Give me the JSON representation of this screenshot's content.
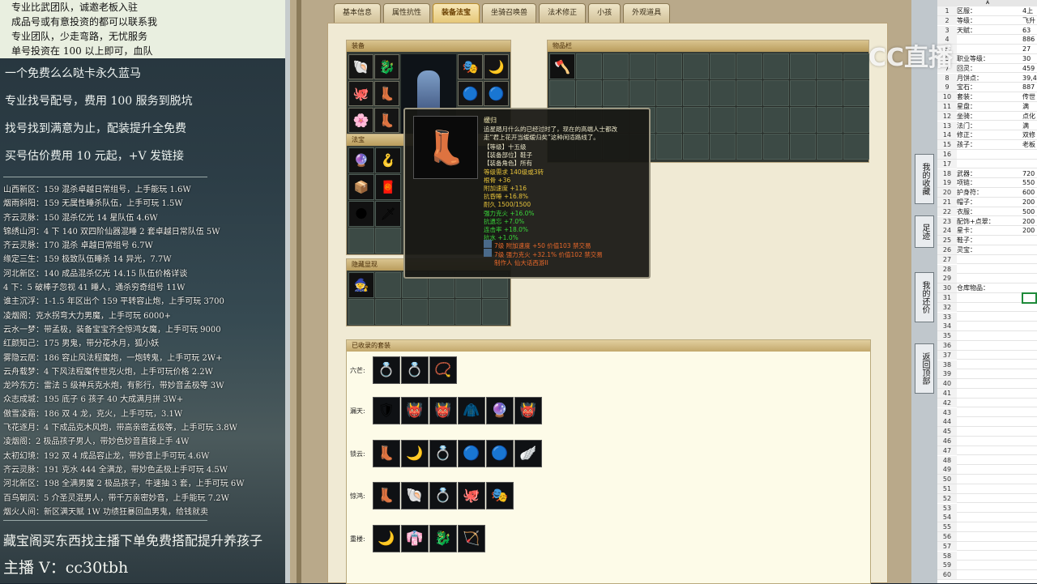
{
  "left_overlay": {
    "top_notice": [
      "专业比武团队，诚邀老板入驻",
      "成品号或有意投资的都可以联系我",
      "专业团队，少走弯路，无忧服务",
      "单号投资在 100 以上即可，血队"
    ],
    "promos": [
      "一个免费么么哒卡永久蓝马",
      "专业找号配号，费用 100 服务到脱坑",
      "找号找到满意为止，配装提升全免费",
      "买号估价费用 10 元起，+V 发链接"
    ],
    "listings": [
      "山西新区：159 混杀卓越日常组号，上手能玩 1.6W",
      "烟雨斜阳：159 无属性睡杀队伍，上手可玩 1.5W",
      "齐云灵脉：150 混杀亿光 14 星队伍 4.6W",
      "锦绣山河：4 下 140 双四阶仙器混睡 2 套卓越日常队伍 5W",
      "齐云灵脉：170 混杀 卓越日常组号 6.7W",
      "缘定三生：159 极致队伍睡杀 14 异光，7.7W",
      "河北新区：140 成品混杀亿光 14.15 队伍价格详谈",
      "4 下：5 破棒子忽视 41 睡人，通杀穷奇组号 11W",
      "谁主沉浮：1-1.5 年区出个 159 平转容止炮，上手可玩 3700",
      "凌烟阁：克水拐弯大力男魔，上手可玩 6000+",
      "云水一梦：带孟极，装备宝宝齐全惊鸿女魔，上手可玩 9000",
      "红颜知己：175 男鬼，带分花水月，狐小妖",
      "雾隐云居：186 容止风法程魔炮，一炮转鬼，上手可玩 2W+",
      "云舟载梦：4 下风法程魔传世克火炮，上手可玩价格 2.2W",
      "龙吟东方：雷法 5 级神兵克水炮，有影行，带妙音孟极等 3W",
      "众志成城：195 底子 6 孩子 40 大成满月拼 3W+",
      "傲雪凌霜：186 双 4 龙，克火，上手可玩，3.1W",
      "飞花逐月：4 下成品克木风炮，带高亲密孟极等，上手可玩 3.8W",
      "凌烟阁：2 极品孩子男人，带妙色妙音直接上手 4W",
      "太初幻境：192 双 4 成品容止龙，带妙音上手可玩 4.6W",
      "齐云灵脉：191 克水 444 全满龙，带妙色孟极上手可玩 4.5W",
      "河北新区：198 全满男魔 2 极品孩子，牛速抽 3 套，上手可玩 6W",
      "百鸟朝凤：5 介圣灵混男人，带千万亲密妙音，上手能玩 7.2W",
      "烟火人间：新区满天赋 1W 功绩狂暴回血男鬼，给钱就卖"
    ],
    "promo_bottom": "藏宝阁买东西找主播下单免费搭配提升养孩子",
    "streamer": "主播 V：cc30tbh"
  },
  "game": {
    "tabs": [
      "基本信息",
      "属性抗性",
      "装备法宝",
      "坐骑召唤兽",
      "法术修正",
      "小孩",
      "外观道具"
    ],
    "active_tab": "装备法宝",
    "equip_title": "装备",
    "inventory_title": "物品栏",
    "fabao_title": "法宝",
    "hidden_title": "隐藏显现",
    "sets_title": "已收录的套装",
    "sets": [
      {
        "name": "六芒:",
        "count": 3,
        "icons": [
          "💍",
          "💍",
          "📿"
        ]
      },
      {
        "name": "漏天:",
        "count": 6,
        "icons": [
          "🛡",
          "👹",
          "👹",
          "🧥",
          "🔮",
          "👹"
        ]
      },
      {
        "name": "锁云:",
        "count": 6,
        "icons": [
          "👢",
          "🌙",
          "💍",
          "🔵",
          "🔵",
          "🪽"
        ]
      },
      {
        "name": "惊鸿:",
        "count": 5,
        "icons": [
          "👢",
          "🐚",
          "💍",
          "🐙",
          "🎭"
        ]
      },
      {
        "name": "重楼:",
        "count": 4,
        "icons": [
          "🌙",
          "👘",
          "🐉",
          "🏹"
        ]
      }
    ],
    "tooltip": {
      "name": "缓归",
      "desc1": "追星踏月什么的已经过时了，现在的高端人士都改",
      "desc2": "走“君上花开当缓缓归矣”这种闲适路线了。",
      "stats": [
        {
          "t": "【等级】十五级",
          "c": "#e8e3c6"
        },
        {
          "t": "【装备部位】鞋子",
          "c": "#e8e3c6"
        },
        {
          "t": "【装备角色】所有",
          "c": "#e8e3c6"
        },
        {
          "t": "等级需求 140级或3转",
          "c": "#e6c23a"
        },
        {
          "t": "根骨 +36",
          "c": "#e6c23a"
        },
        {
          "t": "附加速度 +116",
          "c": "#e6c23a"
        },
        {
          "t": "抗昏睡 +16.8%",
          "c": "#e6c23a"
        },
        {
          "t": "耐久 1500/1500",
          "c": "#e6c23a"
        },
        {
          "t": "强力克火 +16.0%",
          "c": "#3ad43a"
        },
        {
          "t": "抗遗忘 +7.0%",
          "c": "#3ad43a"
        },
        {
          "t": "连击率 +18.0%",
          "c": "#3ad43a"
        },
        {
          "t": "抗水 +1.0%",
          "c": "#3ad43a"
        },
        {
          "t": "7级 附加速度 +50 价值103 禁交易",
          "c": "#e8682a"
        },
        {
          "t": "7级 强力克火 +32.1% 价值102 禁交易",
          "c": "#e8682a"
        },
        {
          "t": "制作人 仙大话西游II",
          "c": "#e8682a"
        }
      ]
    }
  },
  "sidebar": {
    "buttons": [
      "我的收藏",
      "足迹",
      "我的还价",
      "返回顶部"
    ]
  },
  "sheet": {
    "col_header": "A",
    "rows": [
      {
        "n": "1",
        "a": "区服：",
        "b": "4上"
      },
      {
        "n": "2",
        "a": "等级：",
        "b": "飞升"
      },
      {
        "n": "3",
        "a": "天赋：",
        "b": "63"
      },
      {
        "n": "4",
        "a": "",
        "b": "886"
      },
      {
        "n": "5",
        "a": "",
        "b": "27"
      },
      {
        "n": "6",
        "a": "职业等级：",
        "b": "30"
      },
      {
        "n": "7",
        "a": "回灵：",
        "b": "459"
      },
      {
        "n": "8",
        "a": "月饼点：",
        "b": "39,4"
      },
      {
        "n": "9",
        "a": "宝石：",
        "b": "887"
      },
      {
        "n": "10",
        "a": "套装：",
        "b": "传世"
      },
      {
        "n": "11",
        "a": "星盘：",
        "b": "满"
      },
      {
        "n": "12",
        "a": "坐骑：",
        "b": "点化"
      },
      {
        "n": "13",
        "a": "法门：",
        "b": "满"
      },
      {
        "n": "14",
        "a": "修正：",
        "b": "双修"
      },
      {
        "n": "15",
        "a": "孩子：",
        "b": "老板"
      },
      {
        "n": "16",
        "a": "",
        "b": ""
      },
      {
        "n": "17",
        "a": "",
        "b": ""
      },
      {
        "n": "18",
        "a": "武器：",
        "b": "720"
      },
      {
        "n": "19",
        "a": "项链：",
        "b": "550"
      },
      {
        "n": "20",
        "a": "护身符：",
        "b": "600"
      },
      {
        "n": "21",
        "a": "帽子：",
        "b": "200"
      },
      {
        "n": "22",
        "a": "衣服：",
        "b": "500"
      },
      {
        "n": "23",
        "a": "配饰+点翠：",
        "b": "200"
      },
      {
        "n": "24",
        "a": "星卡：",
        "b": "200"
      },
      {
        "n": "25",
        "a": "鞋子：",
        "b": ""
      },
      {
        "n": "26",
        "a": "灵宝：",
        "b": ""
      },
      {
        "n": "27",
        "a": "",
        "b": ""
      },
      {
        "n": "28",
        "a": "",
        "b": ""
      },
      {
        "n": "29",
        "a": "",
        "b": ""
      },
      {
        "n": "30",
        "a": "仓库物品：",
        "b": ""
      },
      {
        "n": "31",
        "a": "",
        "b": ""
      },
      {
        "n": "32",
        "a": "",
        "b": ""
      },
      {
        "n": "33",
        "a": "",
        "b": ""
      },
      {
        "n": "34",
        "a": "",
        "b": ""
      },
      {
        "n": "35",
        "a": "",
        "b": ""
      },
      {
        "n": "36",
        "a": "",
        "b": ""
      },
      {
        "n": "37",
        "a": "",
        "b": ""
      },
      {
        "n": "38",
        "a": "",
        "b": ""
      },
      {
        "n": "39",
        "a": "",
        "b": ""
      },
      {
        "n": "40",
        "a": "",
        "b": ""
      },
      {
        "n": "41",
        "a": "",
        "b": ""
      },
      {
        "n": "42",
        "a": "",
        "b": ""
      },
      {
        "n": "43",
        "a": "",
        "b": ""
      },
      {
        "n": "44",
        "a": "",
        "b": ""
      },
      {
        "n": "45",
        "a": "",
        "b": ""
      },
      {
        "n": "46",
        "a": "",
        "b": ""
      },
      {
        "n": "47",
        "a": "",
        "b": ""
      },
      {
        "n": "48",
        "a": "",
        "b": ""
      },
      {
        "n": "49",
        "a": "",
        "b": ""
      },
      {
        "n": "50",
        "a": "",
        "b": ""
      },
      {
        "n": "51",
        "a": "",
        "b": ""
      },
      {
        "n": "52",
        "a": "",
        "b": ""
      },
      {
        "n": "53",
        "a": "",
        "b": ""
      },
      {
        "n": "54",
        "a": "",
        "b": ""
      },
      {
        "n": "55",
        "a": "",
        "b": ""
      },
      {
        "n": "56",
        "a": "",
        "b": ""
      },
      {
        "n": "57",
        "a": "",
        "b": ""
      },
      {
        "n": "58",
        "a": "",
        "b": ""
      },
      {
        "n": "59",
        "a": "",
        "b": ""
      },
      {
        "n": "60",
        "a": "",
        "b": ""
      }
    ]
  },
  "watermark": "CC直播"
}
